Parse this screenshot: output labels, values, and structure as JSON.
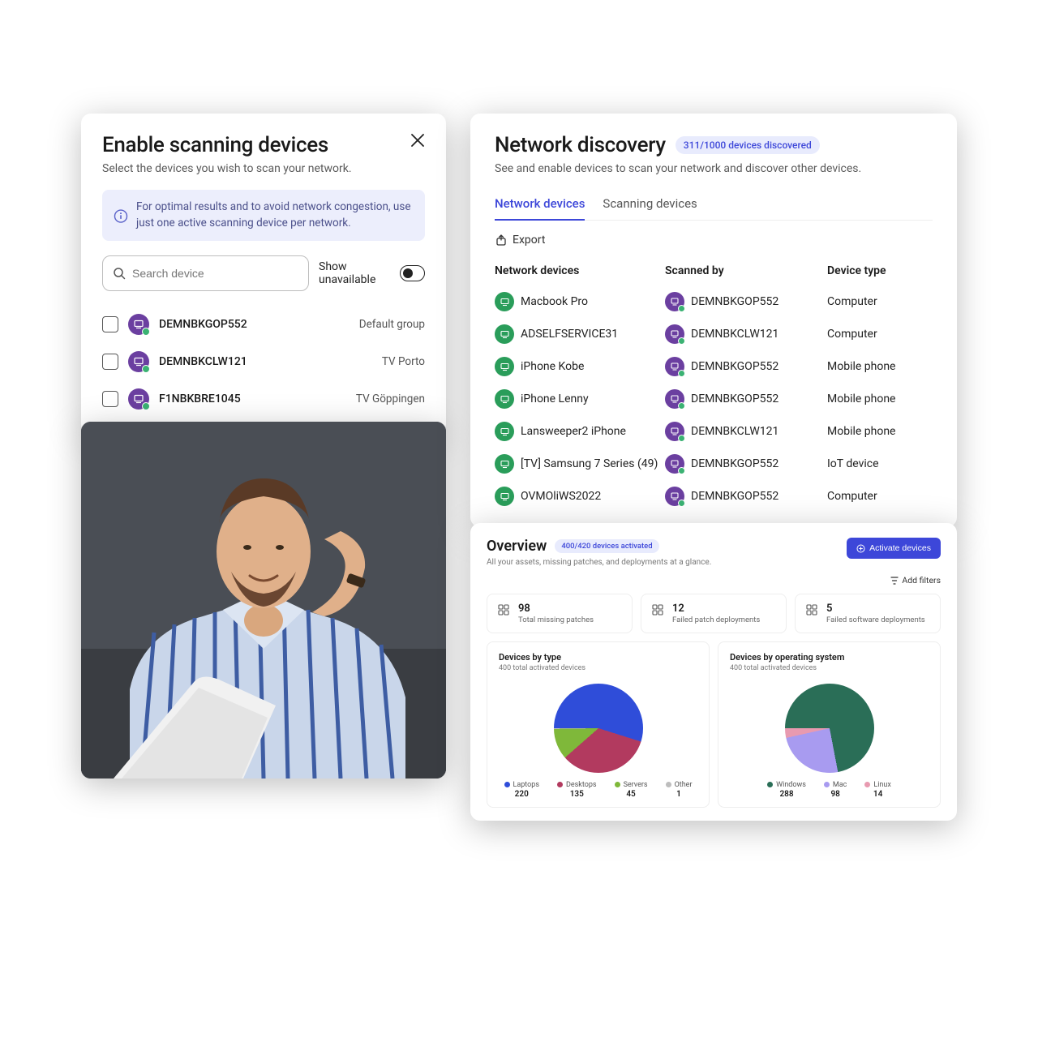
{
  "cardA": {
    "title": "Enable scanning devices",
    "subtitle": "Select the devices you wish to scan your network.",
    "info": "For optimal results and to avoid network congestion, use just one active scanning device per network.",
    "search_placeholder": "Search device",
    "toggle_label": "Show unavailable",
    "devices": [
      {
        "name": "DEMNBKGOP552",
        "group": "Default group"
      },
      {
        "name": "DEMNBKCLW121",
        "group": "TV Porto"
      },
      {
        "name": "F1NBKBRE1045",
        "group": "TV Göppingen"
      }
    ]
  },
  "cardB": {
    "title": "Network discovery",
    "pill": "311/1000 devices discovered",
    "subtitle": "See and enable devices to scan your network and discover other devices.",
    "tabs": [
      "Network devices",
      "Scanning devices"
    ],
    "export_label": "Export",
    "headers": {
      "c1": "Network devices",
      "c2": "Scanned by",
      "c3": "Device type"
    },
    "rows": [
      {
        "device": "Macbook Pro",
        "scanned_by": "DEMNBKGOP552",
        "type": "Computer"
      },
      {
        "device": "ADSELFSERVICE31",
        "scanned_by": "DEMNBKCLW121",
        "type": "Computer"
      },
      {
        "device": "iPhone Kobe",
        "scanned_by": "DEMNBKGOP552",
        "type": "Mobile phone"
      },
      {
        "device": "iPhone Lenny",
        "scanned_by": "DEMNBKGOP552",
        "type": "Mobile phone"
      },
      {
        "device": "Lansweeper2 iPhone",
        "scanned_by": "DEMNBKCLW121",
        "type": "Mobile phone"
      },
      {
        "device": "[TV] Samsung 7 Series (49)",
        "scanned_by": "DEMNBKGOP552",
        "type": "IoT device"
      },
      {
        "device": "OVMOliWS2022",
        "scanned_by": "DEMNBKGOP552",
        "type": "Computer"
      }
    ]
  },
  "cardC": {
    "title": "Overview",
    "pill": "400/420 devices activated",
    "subtitle": "All your assets, missing patches, and deployments at a glance.",
    "activate_btn": "Activate devices",
    "add_filters": "Add filters",
    "stats": [
      {
        "value": "98",
        "label": "Total missing patches"
      },
      {
        "value": "12",
        "label": "Failed patch deployments"
      },
      {
        "value": "5",
        "label": "Failed software deployments"
      }
    ],
    "chart1": {
      "title": "Devices by type",
      "subtitle": "400 total activated devices",
      "items": [
        {
          "label": "Laptops",
          "value": "220",
          "color": "#2f4dd9"
        },
        {
          "label": "Desktops",
          "value": "135",
          "color": "#b23a5f"
        },
        {
          "label": "Servers",
          "value": "45",
          "color": "#7fb83a"
        },
        {
          "label": "Other",
          "value": "1",
          "color": "#bdbdbd"
        }
      ]
    },
    "chart2": {
      "title": "Devices by operating system",
      "subtitle": "400 total activated devices",
      "items": [
        {
          "label": "Windows",
          "value": "288",
          "color": "#2a6e57"
        },
        {
          "label": "Mac",
          "value": "98",
          "color": "#a89bf0"
        },
        {
          "label": "Linux",
          "value": "14",
          "color": "#e89ab0"
        }
      ]
    }
  },
  "chart_data": [
    {
      "type": "pie",
      "title": "Devices by type",
      "categories": [
        "Laptops",
        "Desktops",
        "Servers",
        "Other"
      ],
      "values": [
        220,
        135,
        45,
        1
      ]
    },
    {
      "type": "pie",
      "title": "Devices by operating system",
      "categories": [
        "Windows",
        "Mac",
        "Linux"
      ],
      "values": [
        288,
        98,
        14
      ]
    }
  ]
}
